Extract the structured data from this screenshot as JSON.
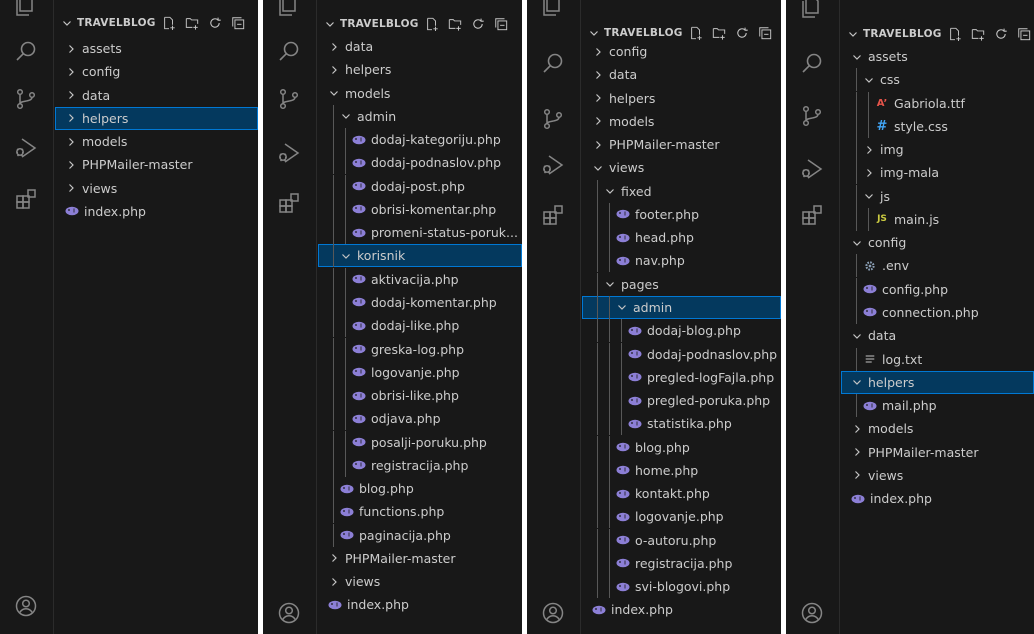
{
  "colors": {
    "php": "#8c7fd6",
    "selected_bg": "#04395e",
    "selected_border": "#0078d4",
    "css": "#42a5f5",
    "font": "#e5544a",
    "js": "#cbcb41",
    "gear": "#8a9fb5",
    "text": "#cccccc"
  },
  "activity_icons": [
    "explorer-icon",
    "search-icon",
    "source-control-icon",
    "run-debug-icon",
    "extensions-icon",
    "account-icon"
  ],
  "header_icons": [
    "new-file-icon",
    "new-folder-icon",
    "refresh-icon",
    "collapse-all-icon"
  ],
  "panels": [
    {
      "root": "TRAVELBLOG",
      "items": [
        {
          "label": "assets",
          "type": "folder",
          "depth": 0,
          "open": false
        },
        {
          "label": "config",
          "type": "folder",
          "depth": 0,
          "open": false
        },
        {
          "label": "data",
          "type": "folder",
          "depth": 0,
          "open": false
        },
        {
          "label": "helpers",
          "type": "folder",
          "depth": 0,
          "open": false,
          "selected": true
        },
        {
          "label": "models",
          "type": "folder",
          "depth": 0,
          "open": false
        },
        {
          "label": "PHPMailer-master",
          "type": "folder",
          "depth": 0,
          "open": false
        },
        {
          "label": "views",
          "type": "folder",
          "depth": 0,
          "open": false
        },
        {
          "label": "index.php",
          "type": "php",
          "depth": 0
        }
      ]
    },
    {
      "root": "TRAVELBLOG",
      "items": [
        {
          "label": "data",
          "type": "folder",
          "depth": 0,
          "open": false
        },
        {
          "label": "helpers",
          "type": "folder",
          "depth": 0,
          "open": false
        },
        {
          "label": "models",
          "type": "folder",
          "depth": 0,
          "open": true
        },
        {
          "label": "admin",
          "type": "folder",
          "depth": 1,
          "open": true
        },
        {
          "label": "dodaj-kategoriju.php",
          "type": "php",
          "depth": 2
        },
        {
          "label": "dodaj-podnaslov.php",
          "type": "php",
          "depth": 2
        },
        {
          "label": "dodaj-post.php",
          "type": "php",
          "depth": 2
        },
        {
          "label": "obrisi-komentar.php",
          "type": "php",
          "depth": 2
        },
        {
          "label": "promeni-status-poruk...",
          "type": "php",
          "depth": 2
        },
        {
          "label": "korisnik",
          "type": "folder",
          "depth": 1,
          "open": true,
          "selected": true
        },
        {
          "label": "aktivacija.php",
          "type": "php",
          "depth": 2
        },
        {
          "label": "dodaj-komentar.php",
          "type": "php",
          "depth": 2
        },
        {
          "label": "dodaj-like.php",
          "type": "php",
          "depth": 2
        },
        {
          "label": "greska-log.php",
          "type": "php",
          "depth": 2
        },
        {
          "label": "logovanje.php",
          "type": "php",
          "depth": 2
        },
        {
          "label": "obrisi-like.php",
          "type": "php",
          "depth": 2
        },
        {
          "label": "odjava.php",
          "type": "php",
          "depth": 2
        },
        {
          "label": "posalji-poruku.php",
          "type": "php",
          "depth": 2
        },
        {
          "label": "registracija.php",
          "type": "php",
          "depth": 2
        },
        {
          "label": "blog.php",
          "type": "php",
          "depth": 1
        },
        {
          "label": "functions.php",
          "type": "php",
          "depth": 1
        },
        {
          "label": "paginacija.php",
          "type": "php",
          "depth": 1
        },
        {
          "label": "PHPMailer-master",
          "type": "folder",
          "depth": 0,
          "open": false
        },
        {
          "label": "views",
          "type": "folder",
          "depth": 0,
          "open": false
        },
        {
          "label": "index.php",
          "type": "php",
          "depth": 0
        }
      ]
    },
    {
      "root": "TRAVELBLOG",
      "items": [
        {
          "label": "config",
          "type": "folder",
          "depth": 0,
          "open": false
        },
        {
          "label": "data",
          "type": "folder",
          "depth": 0,
          "open": false
        },
        {
          "label": "helpers",
          "type": "folder",
          "depth": 0,
          "open": false
        },
        {
          "label": "models",
          "type": "folder",
          "depth": 0,
          "open": false
        },
        {
          "label": "PHPMailer-master",
          "type": "folder",
          "depth": 0,
          "open": false
        },
        {
          "label": "views",
          "type": "folder",
          "depth": 0,
          "open": true
        },
        {
          "label": "fixed",
          "type": "folder",
          "depth": 1,
          "open": true
        },
        {
          "label": "footer.php",
          "type": "php",
          "depth": 2
        },
        {
          "label": "head.php",
          "type": "php",
          "depth": 2
        },
        {
          "label": "nav.php",
          "type": "php",
          "depth": 2
        },
        {
          "label": "pages",
          "type": "folder",
          "depth": 1,
          "open": true
        },
        {
          "label": "admin",
          "type": "folder",
          "depth": 2,
          "open": true,
          "selected": true
        },
        {
          "label": "dodaj-blog.php",
          "type": "php",
          "depth": 3
        },
        {
          "label": "dodaj-podnaslov.php",
          "type": "php",
          "depth": 3
        },
        {
          "label": "pregled-logFajla.php",
          "type": "php",
          "depth": 3
        },
        {
          "label": "pregled-poruka.php",
          "type": "php",
          "depth": 3
        },
        {
          "label": "statistika.php",
          "type": "php",
          "depth": 3
        },
        {
          "label": "blog.php",
          "type": "php",
          "depth": 2
        },
        {
          "label": "home.php",
          "type": "php",
          "depth": 2
        },
        {
          "label": "kontakt.php",
          "type": "php",
          "depth": 2
        },
        {
          "label": "logovanje.php",
          "type": "php",
          "depth": 2
        },
        {
          "label": "o-autoru.php",
          "type": "php",
          "depth": 2
        },
        {
          "label": "registracija.php",
          "type": "php",
          "depth": 2
        },
        {
          "label": "svi-blogovi.php",
          "type": "php",
          "depth": 2
        },
        {
          "label": "index.php",
          "type": "php",
          "depth": 0
        }
      ]
    },
    {
      "root": "TRAVELBLOG",
      "items": [
        {
          "label": "assets",
          "type": "folder",
          "depth": 0,
          "open": true
        },
        {
          "label": "css",
          "type": "folder",
          "depth": 1,
          "open": true
        },
        {
          "label": "Gabriola.ttf",
          "type": "font",
          "depth": 2
        },
        {
          "label": "style.css",
          "type": "css",
          "depth": 2
        },
        {
          "label": "img",
          "type": "folder",
          "depth": 1,
          "open": false
        },
        {
          "label": "img-mala",
          "type": "folder",
          "depth": 1,
          "open": false
        },
        {
          "label": "js",
          "type": "folder",
          "depth": 1,
          "open": true
        },
        {
          "label": "main.js",
          "type": "js",
          "depth": 2
        },
        {
          "label": "config",
          "type": "folder",
          "depth": 0,
          "open": true
        },
        {
          "label": ".env",
          "type": "env",
          "depth": 1
        },
        {
          "label": "config.php",
          "type": "php",
          "depth": 1
        },
        {
          "label": "connection.php",
          "type": "php",
          "depth": 1
        },
        {
          "label": "data",
          "type": "folder",
          "depth": 0,
          "open": true
        },
        {
          "label": "log.txt",
          "type": "txt",
          "depth": 1
        },
        {
          "label": "helpers",
          "type": "folder",
          "depth": 0,
          "open": true,
          "selected": true
        },
        {
          "label": "mail.php",
          "type": "php",
          "depth": 1
        },
        {
          "label": "models",
          "type": "folder",
          "depth": 0,
          "open": false
        },
        {
          "label": "PHPMailer-master",
          "type": "folder",
          "depth": 0,
          "open": false
        },
        {
          "label": "views",
          "type": "folder",
          "depth": 0,
          "open": false
        },
        {
          "label": "index.php",
          "type": "php",
          "depth": 0
        }
      ]
    }
  ]
}
